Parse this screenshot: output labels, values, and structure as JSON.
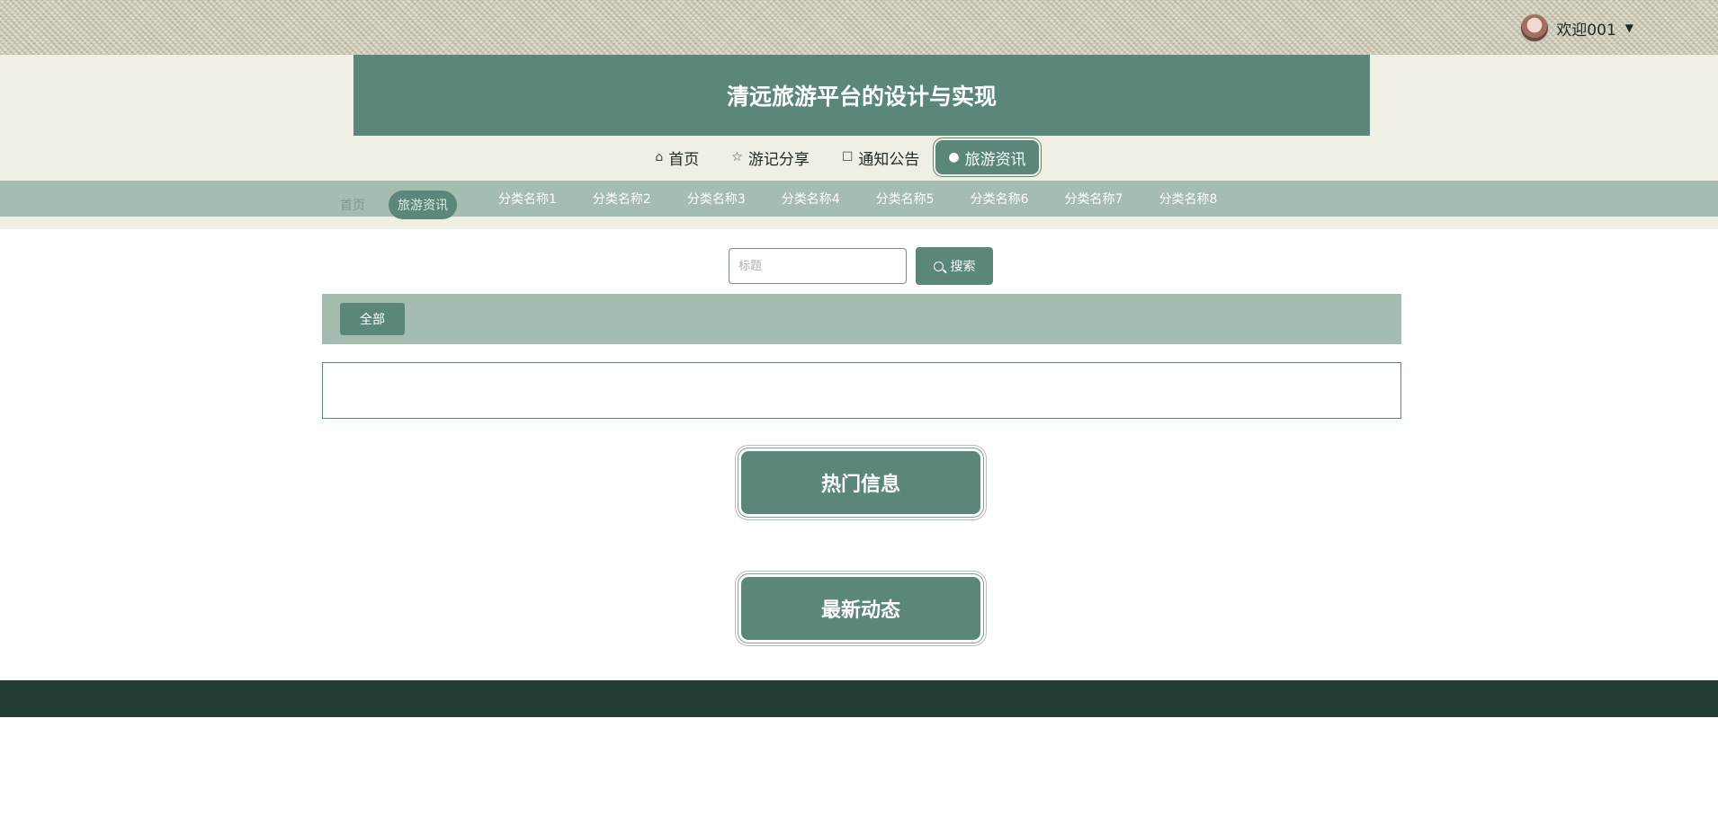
{
  "user": {
    "greeting": "欢迎001",
    "avatar_icon": "avatar-icon",
    "dropdown_icon": "caret-down-icon"
  },
  "header": {
    "title": "清远旅游平台的设计与实现"
  },
  "nav": {
    "items": [
      {
        "label": "首页",
        "icon": "home-icon",
        "active": false
      },
      {
        "label": "游记分享",
        "icon": "star-icon",
        "active": false
      },
      {
        "label": "通知公告",
        "icon": "bag-icon",
        "active": false
      },
      {
        "label": "旅游资讯",
        "icon": "info-circle-icon",
        "active": true
      }
    ]
  },
  "subnav": {
    "home": "首页",
    "current": "旅游资讯",
    "categories": [
      "分类名称1",
      "分类名称2",
      "分类名称3",
      "分类名称4",
      "分类名称5",
      "分类名称6",
      "分类名称7",
      "分类名称8"
    ]
  },
  "search": {
    "placeholder": "标题",
    "value": "",
    "button_label": "搜索"
  },
  "filter": {
    "all_label": "全部"
  },
  "sections": {
    "hot": "热门信息",
    "latest": "最新动态"
  },
  "colors": {
    "primary": "#5a877a",
    "light": "#a5bcb0",
    "band": "#eff0e3",
    "footer": "#203c35"
  }
}
